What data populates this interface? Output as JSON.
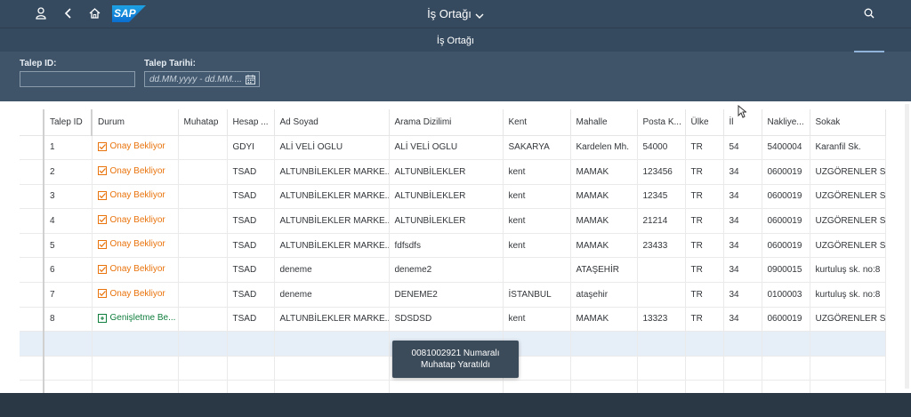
{
  "shell": {
    "title": "İş Ortağı",
    "logo_text": "SAP"
  },
  "page": {
    "title": "İş Ortağı"
  },
  "filters": {
    "request_id_label": "Talep ID:",
    "request_id_value": "",
    "request_date_label": "Talep Tarihi:",
    "request_date_placeholder": "dd.MM.yyyy - dd.MM...."
  },
  "table": {
    "columns": [
      "Talep ID",
      "Durum",
      "Muhatap",
      "Hesap ...",
      "Ad Soyad",
      "Arama Dizilimi",
      "Kent",
      "Mahalle",
      "Posta K...",
      "Ülke",
      "İl",
      "Nakliye...",
      "Sokak"
    ],
    "rows": [
      {
        "id": "1",
        "status": "Onay Bekliyor",
        "status_type": "wait",
        "muhatap": "",
        "hesap": "GDYI",
        "ad": "ALİ VELİ OGLU",
        "arama": "ALİ VELİ OGLU",
        "kent": "SAKARYA",
        "mahalle": "Kardelen Mh.",
        "posta": "54000",
        "ulke": "TR",
        "il": "54",
        "nakliye": "5400004",
        "sokak": "Karanfil Sk."
      },
      {
        "id": "2",
        "status": "Onay Bekliyor",
        "status_type": "wait",
        "muhatap": "",
        "hesap": "TSAD",
        "ad": "ALTUNBİLEKLER MARKE...",
        "arama": "ALTUNBİLEKLER",
        "kent": "kent",
        "mahalle": "MAMAK",
        "posta": "123456",
        "ulke": "TR",
        "il": "34",
        "nakliye": "0600019",
        "sokak": "UZGÖRENLER SOK"
      },
      {
        "id": "3",
        "status": "Onay Bekliyor",
        "status_type": "wait",
        "muhatap": "",
        "hesap": "TSAD",
        "ad": "ALTUNBİLEKLER MARKE...",
        "arama": "ALTUNBİLEKLER",
        "kent": "kent",
        "mahalle": "MAMAK",
        "posta": "12345",
        "ulke": "TR",
        "il": "34",
        "nakliye": "0600019",
        "sokak": "UZGÖRENLER SOK"
      },
      {
        "id": "4",
        "status": "Onay Bekliyor",
        "status_type": "wait",
        "muhatap": "",
        "hesap": "TSAD",
        "ad": "ALTUNBİLEKLER MARKE...",
        "arama": "ALTUNBİLEKLER",
        "kent": "kent",
        "mahalle": "MAMAK",
        "posta": "21214",
        "ulke": "TR",
        "il": "34",
        "nakliye": "0600019",
        "sokak": "UZGÖRENLER SOK"
      },
      {
        "id": "5",
        "status": "Onay Bekliyor",
        "status_type": "wait",
        "muhatap": "",
        "hesap": "TSAD",
        "ad": "ALTUNBİLEKLER MARKE...",
        "arama": "fdfsdfs",
        "kent": "kent",
        "mahalle": "MAMAK",
        "posta": "23433",
        "ulke": "TR",
        "il": "34",
        "nakliye": "0600019",
        "sokak": "UZGÖRENLER SOK"
      },
      {
        "id": "6",
        "status": "Onay Bekliyor",
        "status_type": "wait",
        "muhatap": "",
        "hesap": "TSAD",
        "ad": "deneme",
        "arama": "deneme2",
        "kent": "",
        "mahalle": "ATAŞEHİR",
        "posta": "",
        "ulke": "TR",
        "il": "34",
        "nakliye": "0900015",
        "sokak": "kurtuluş sk. no:8"
      },
      {
        "id": "7",
        "status": "Onay Bekliyor",
        "status_type": "wait",
        "muhatap": "",
        "hesap": "TSAD",
        "ad": "deneme",
        "arama": "DENEME2",
        "kent": "İSTANBUL",
        "mahalle": "ataşehir",
        "posta": "",
        "ulke": "TR",
        "il": "34",
        "nakliye": "0100003",
        "sokak": "kurtuluş sk. no:8"
      },
      {
        "id": "8",
        "status": "Genişletme Be...",
        "status_type": "ext",
        "muhatap": "",
        "hesap": "TSAD",
        "ad": "ALTUNBİLEKLER MARKE...",
        "arama": "SDSDSD",
        "kent": "kent",
        "mahalle": "MAMAK",
        "posta": "13323",
        "ulke": "TR",
        "il": "34",
        "nakliye": "0600019",
        "sokak": "UZGÖRENLER SOK"
      }
    ],
    "empty_rows": 3
  },
  "toast": {
    "line1": "0081002921 Numaralı",
    "line2": "Muhatap Yaratıldı"
  },
  "colors": {
    "shell": "#354a5f",
    "wait": "#e9730c",
    "extension": "#107e3e"
  },
  "icons": {
    "user": "user-icon",
    "back": "back-icon",
    "home": "home-icon",
    "search": "search-icon",
    "calendar": "calendar-icon"
  }
}
